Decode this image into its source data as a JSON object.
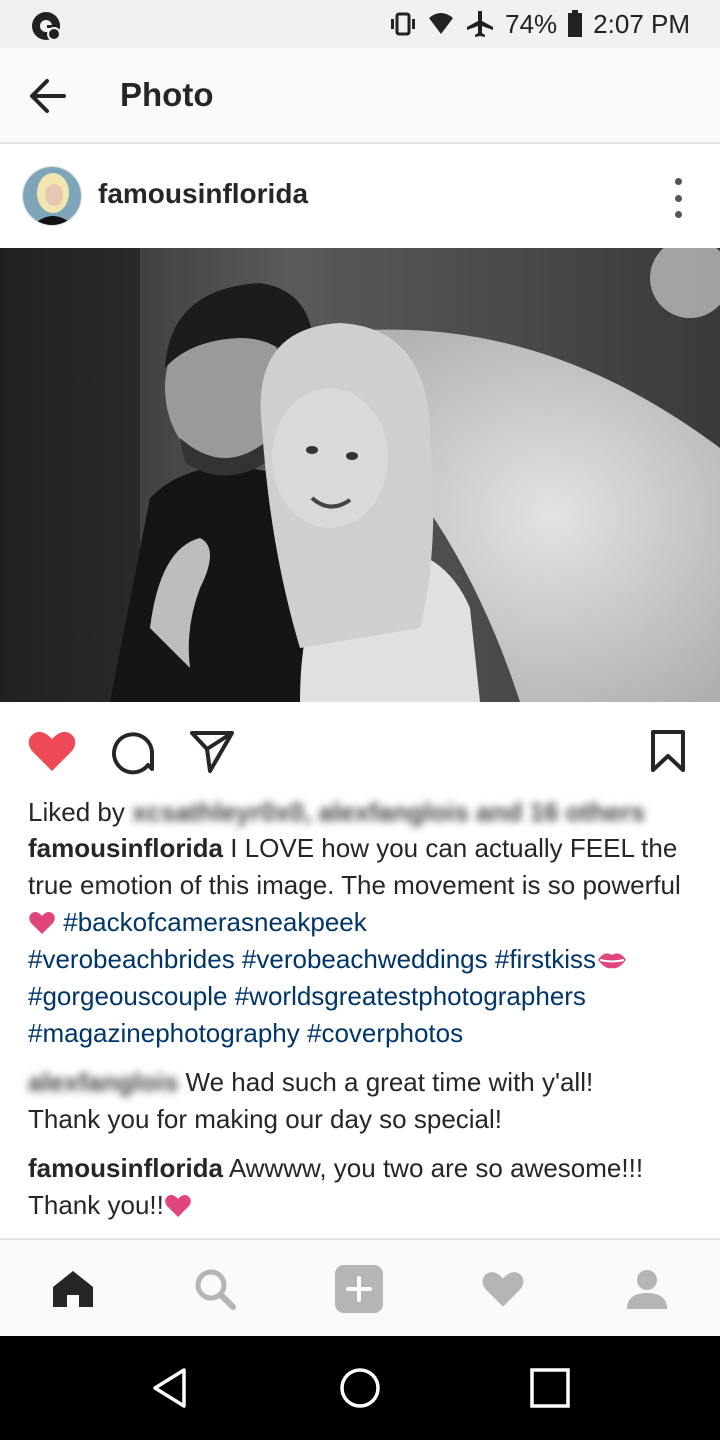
{
  "status_bar": {
    "battery": "74%",
    "time": "2:07 PM"
  },
  "app_bar": {
    "title": "Photo"
  },
  "post": {
    "username": "famousinflorida",
    "liked_prefix": "Liked by",
    "liked_names_blurred": "xcsathleyr0x0, alexfanglois and 16 others",
    "caption": {
      "username": "famousinflorida",
      "text": "I LOVE how you can actually FEEL the true emotion of this image. The movement is so powerful",
      "hashtags_line1": "#backofcamerasneakpeek",
      "hashtags_line2": "#verobeachbrides #verobeachweddings #firstkiss",
      "hashtags_line3": "#gorgeouscouple #worldsgreatestphotographers",
      "hashtags_line4": "#magazinephotography #coverphotos"
    },
    "comments": [
      {
        "username_blurred": "alexfanglois",
        "text": "We had such a great time with y'all!",
        "text2": "Thank you for making our day so special!"
      },
      {
        "username": "famousinflorida",
        "text": "Awwww, you two are so awesome!!!",
        "text2": "Thank you!!"
      }
    ]
  },
  "icons": {
    "back": "arrow-left-icon",
    "more": "more-vertical-icon",
    "like": "heart-filled-icon",
    "comment": "comment-icon",
    "share": "send-icon",
    "save": "bookmark-icon",
    "nav": [
      "home-icon",
      "search-icon",
      "add-icon",
      "activity-heart-icon",
      "profile-icon"
    ],
    "system": [
      "back-triangle-icon",
      "home-circle-icon",
      "recents-square-icon"
    ]
  },
  "colors": {
    "like_red": "#ed4956",
    "hashtag": "#003569",
    "emoji_pink": "#e0457b"
  }
}
